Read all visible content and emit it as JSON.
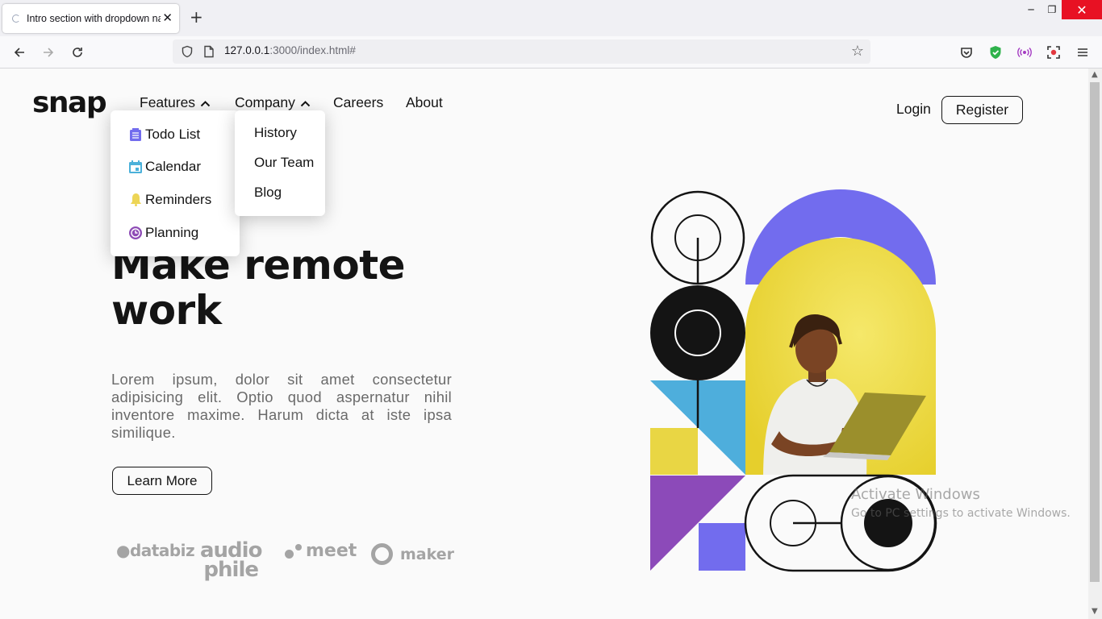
{
  "browser": {
    "tab_title": "Intro section with dropdown na",
    "url_host": "127.0.0.1",
    "url_rest": ":3000/index.html#"
  },
  "site": {
    "logo": "snap",
    "nav": {
      "features": "Features",
      "company": "Company",
      "careers": "Careers",
      "about": "About"
    },
    "auth": {
      "login": "Login",
      "register": "Register"
    },
    "features_menu": [
      "Todo List",
      "Calendar",
      "Reminders",
      "Planning"
    ],
    "company_menu": [
      "History",
      "Our Team",
      "Blog"
    ],
    "hero": {
      "title_line1": "Make remote",
      "title_line2": "work",
      "description": "Lorem ipsum, dolor sit amet consectetur adipisicing elit. Optio quod aspernatur nihil inventore maxime. Harum dicta at iste ipsa similique.",
      "cta": "Learn More"
    },
    "clients": {
      "databiz": "databiz",
      "audio_1": "audio",
      "audio_2": "phile",
      "meet": "meet",
      "maker": "maker"
    }
  },
  "windows_watermark": {
    "title": "Activate Windows",
    "subtitle": "Go to PC settings to activate Windows."
  },
  "colors": {
    "ink": "#141414",
    "purple": "#726cee",
    "yellow": "#e9d644",
    "blue": "#4eaedc",
    "violet": "#8c4ab9",
    "todo_icon": "#726cee",
    "calendar_icon": "#4bb1da",
    "reminders_icon": "#edd556",
    "planning_icon": "#8e4cb6"
  }
}
